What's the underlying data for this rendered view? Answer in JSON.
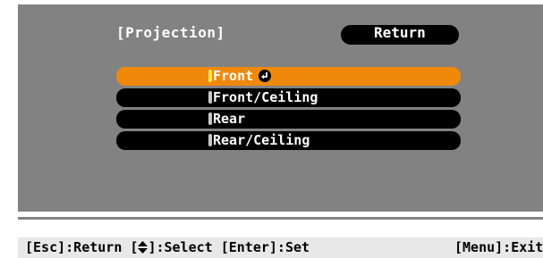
{
  "menu": {
    "title": "[Projection]",
    "return_label": "Return",
    "options": [
      {
        "label": "Front",
        "selected": true
      },
      {
        "label": "Front/Ceiling",
        "selected": false
      },
      {
        "label": "Rear",
        "selected": false
      },
      {
        "label": "Rear/Ceiling",
        "selected": false
      }
    ]
  },
  "footer": {
    "esc": "[Esc]:Return",
    "select_prefix": "[",
    "select_suffix": "]:Select",
    "enter": "[Enter]:Set",
    "menu": "[Menu]:Exit"
  },
  "icons": {
    "enter_icon": "enter-arrow-icon",
    "updown_icon": "up-down-arrow-icon"
  },
  "colors": {
    "panel": "#828282",
    "highlight": "#f0890a",
    "option_bg": "#000000",
    "text": "#ffffff",
    "footer_bg": "#e8e8e8"
  }
}
